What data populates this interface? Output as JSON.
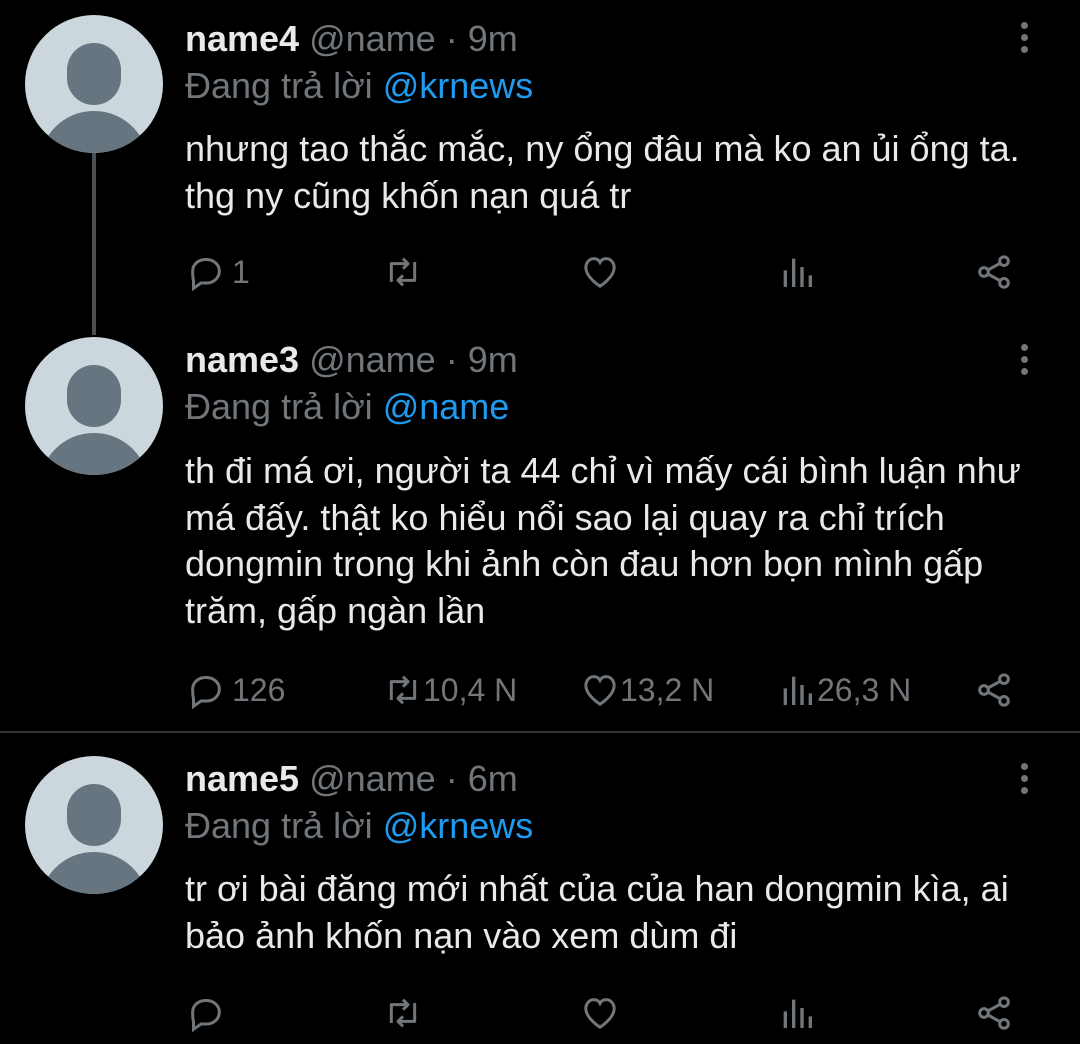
{
  "tweets": [
    {
      "name": "name4",
      "handle": "@name",
      "time": "· 9m",
      "reply_prefix": "Đang trả lời ",
      "reply_to": "@krnews",
      "text": "nhưng tao thắc mắc, ny ổng đâu mà ko an ủi ổng ta. thg ny cũng khốn nạn quá tr",
      "replies": "1",
      "retweets": "",
      "likes": "",
      "views": ""
    },
    {
      "name": "name3",
      "handle": "@name",
      "time": "· 9m",
      "reply_prefix": "Đang trả lời ",
      "reply_to": "@name",
      "text": "th đi má ơi, người ta 44 chỉ vì mấy cái bình luận như má đấy. thật ko hiểu nổi sao lại quay ra chỉ trích dongmin trong khi ảnh còn đau hơn bọn mình gấp trăm, gấp ngàn lần",
      "replies": "126",
      "retweets": "10,4 N",
      "likes": "13,2 N",
      "views": "26,3 N"
    },
    {
      "name": "name5",
      "handle": "@name",
      "time": "· 6m",
      "reply_prefix": "Đang trả lời ",
      "reply_to": "@krnews",
      "text": "tr ơi bài đăng mới nhất của của han dongmin kìa, ai bảo ảnh khốn nạn vào xem dùm đi",
      "replies": "",
      "retweets": "",
      "likes": "",
      "views": ""
    }
  ],
  "icons": {
    "reply": "reply-icon",
    "retweet": "retweet-icon",
    "like": "heart-icon",
    "views": "views-icon",
    "share": "share-icon",
    "more": "more-vertical-icon"
  },
  "colors": {
    "background": "#000000",
    "text": "#e7e9ea",
    "muted": "#71767b",
    "link": "#1d9bf0",
    "avatar_bg": "#ccd6dd",
    "avatar_fg": "#66757f"
  }
}
